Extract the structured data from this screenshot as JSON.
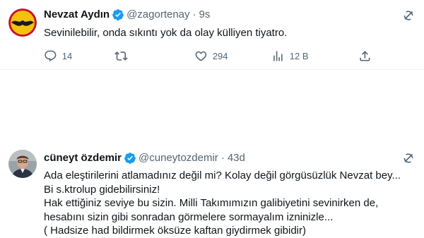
{
  "tweet1": {
    "name": "Nevzat Aydın",
    "handle": "@zagortenay",
    "separator": "·",
    "time": "9s",
    "text": "Sevinilebilir, onda sıkıntı yok da olay külliyen tiyatro.",
    "actions": {
      "replies": "14",
      "retweets": "",
      "likes": "294",
      "views": "12 B"
    }
  },
  "tweet2": {
    "name": "cüneyt özdemir",
    "handle": "@cuneytozdemir",
    "separator": "·",
    "time": "43d",
    "lines": [
      "Ada eleştirilerini atlamadınız değil mi? Kolay değil görgüsüzlük Nevzat bey...",
      "Bi s.ktrolup gidebilirsiniz!",
      "Hak ettiğiniz seviye bu sizin. Milli Takımımızın galibiyetini sevinirken de,",
      "hesabını sizin gibi sonradan görmelere sormayalım izninizle...",
      "( Hadsize had bildirmek öksüze kaftan giydirmek gibidir)"
    ]
  },
  "colors": {
    "text": "#0f1419",
    "secondary": "#536471",
    "verified": "#1d9bf0",
    "divider": "#eff3f4"
  },
  "icons": [
    "verified-badge-icon",
    "grok-icon",
    "reply-icon",
    "retweet-icon",
    "like-icon",
    "views-icon",
    "share-icon"
  ]
}
